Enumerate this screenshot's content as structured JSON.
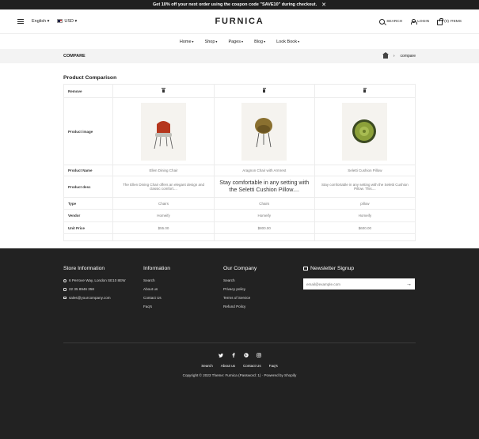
{
  "announcement": {
    "text": "Get 10% off your next order using the coupon code \"SAVE10\" during checkout.",
    "close": "✕"
  },
  "header": {
    "language": "English",
    "currency": "USD",
    "logo": "FURNICA",
    "search": "SEARCH",
    "login": "LOGIN",
    "cart": "(0) ITEMS"
  },
  "nav": [
    "Home",
    "Shop",
    "Pages",
    "Blog",
    "Look Book"
  ],
  "breadcrumb": {
    "title": "COMPARE",
    "separator": "›",
    "current": "compare"
  },
  "compare": {
    "heading": "Product Comparison",
    "labels": {
      "remove": "Remove",
      "image": "Product image",
      "name": "Product Name",
      "desc": "Product desc",
      "type": "Type",
      "vendor": "Vendor",
      "price": "Unit Price"
    },
    "products": [
      {
        "name": "Ellen Dining Chair",
        "desc": "The Ellen Dining Chair offers an elegant design and classic comfort....",
        "type": "Chairs",
        "vendor": "Homeify",
        "price": "$55.00",
        "image": "red-chair"
      },
      {
        "name": "Aragnon Chair with Armrest",
        "desc": "Stay comfortable in any setting with the Seletti Cushion Pillow....",
        "type": "Chairs",
        "vendor": "Homeify",
        "price": "$800.00",
        "image": "olive-bowl-chair"
      },
      {
        "name": "Seletti Cushion Pillow",
        "desc": "Stay comfortable in any setting with the Seletti Cushion Pillow. This....",
        "type": "pillow",
        "vendor": "Homeify",
        "price": "$600.00",
        "image": "round-cushion"
      }
    ]
  },
  "footer": {
    "store": {
      "title": "Store Information",
      "address": "6 Perrove Way, London SE10 8EW",
      "phone": "22 35 8946 358",
      "email": "sales@yourcompany.com"
    },
    "information": {
      "title": "Information",
      "links": [
        "Search",
        "About us",
        "Contact Us",
        "Faq's"
      ]
    },
    "company": {
      "title": "Our Company",
      "links": [
        "Search",
        "Privacy policy",
        "Terms of Service",
        "Refund Policy"
      ]
    },
    "newsletter": {
      "title": "Newsletter Signup",
      "placeholder": "email@example.com",
      "submit": "→"
    },
    "social": [
      "twitter-icon",
      "facebook-icon",
      "pinterest-icon",
      "instagram-icon"
    ],
    "bottom_links": [
      "Search",
      "About us",
      "Contact Us",
      "Faq's"
    ],
    "copyright": "Copyright © 2023 Theme: Furnica (Password: 1) · Powered by Shopify"
  }
}
